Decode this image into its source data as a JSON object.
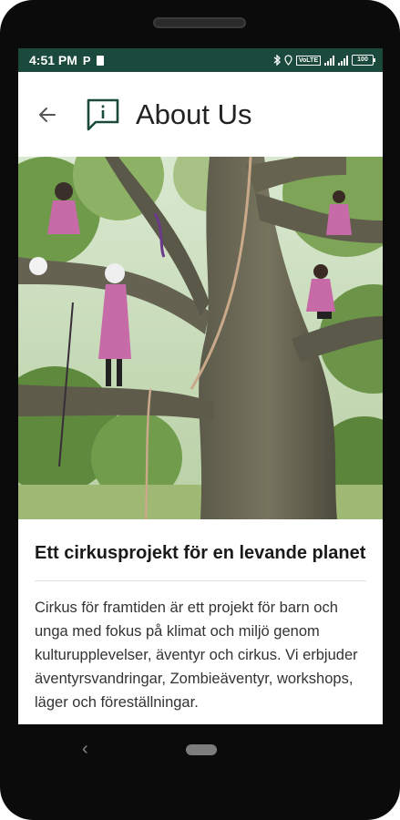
{
  "status_bar": {
    "time": "4:51 PM",
    "app_indicator": "P",
    "volte": "VoLTE",
    "battery": "100"
  },
  "app_bar": {
    "title": "About Us",
    "back_icon": "arrow-left-icon",
    "title_icon": "info-chat-icon"
  },
  "hero": {
    "icon": "photo-tree-circus"
  },
  "article": {
    "headline": "Ett cirkusprojekt för en levande planet",
    "body": "Cirkus för framtiden är ett projekt för barn och unga med fokus på klimat och miljö genom kulturupplevelser, äventyr och cirkus. Vi erbjuder äventyrsvandringar, Zombieäventyr, workshops, läger och föreställningar."
  },
  "nav_bar": {
    "back_glyph": "‹"
  },
  "colors": {
    "status_bar": "#1b4a3c",
    "device_frame": "#0b0b0b",
    "accent": "#1b4a3c"
  }
}
